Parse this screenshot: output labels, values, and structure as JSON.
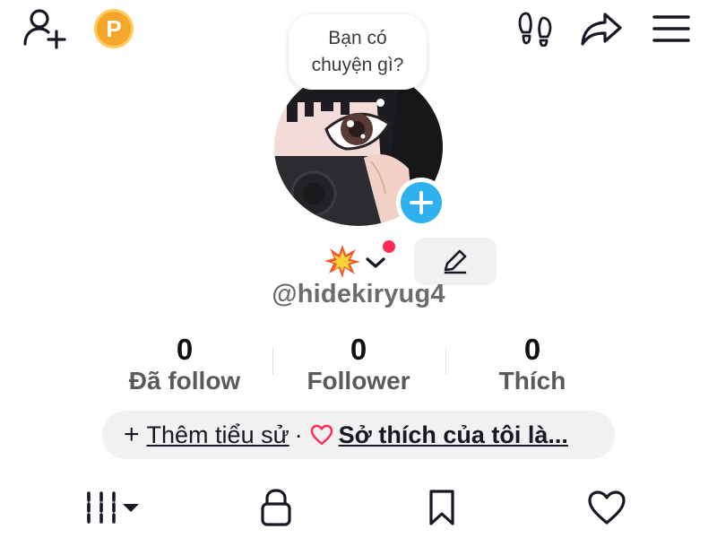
{
  "top_bar": {
    "icons": [
      "add-friend-icon",
      "points-coin-icon",
      "footprints-icon",
      "share-icon",
      "menu-icon"
    ],
    "coin_letter": "P",
    "coin_color": "#f5a52a"
  },
  "avatar": {
    "bubble_line1": "Bạn có",
    "bubble_line2": "chuyện gì?",
    "add_badge_color": "#2eb1ed"
  },
  "profile": {
    "status_emoji": "💥",
    "username": "@hidekiryug4",
    "edit_icon": "pencil-icon"
  },
  "stats": {
    "following": {
      "value": "0",
      "label": "Đã follow"
    },
    "followers": {
      "value": "0",
      "label": "Follower"
    },
    "likes": {
      "value": "0",
      "label": "Thích"
    }
  },
  "bio": {
    "plus": "+",
    "add_bio": "Thêm tiểu sử",
    "separator": "·",
    "hobby_text": "Sở thích của tôi là..."
  },
  "tabs": [
    {
      "name": "videos",
      "icon": "grid-bars-icon",
      "has_dropdown": true
    },
    {
      "name": "private",
      "icon": "lock-icon"
    },
    {
      "name": "saved",
      "icon": "bookmark-icon"
    },
    {
      "name": "liked",
      "icon": "heart-icon"
    }
  ],
  "colors": {
    "accent_red": "#fe2c55",
    "heart_pink": "#fe2c55",
    "text_dark": "#161823",
    "text_gray": "#6b6b70"
  }
}
